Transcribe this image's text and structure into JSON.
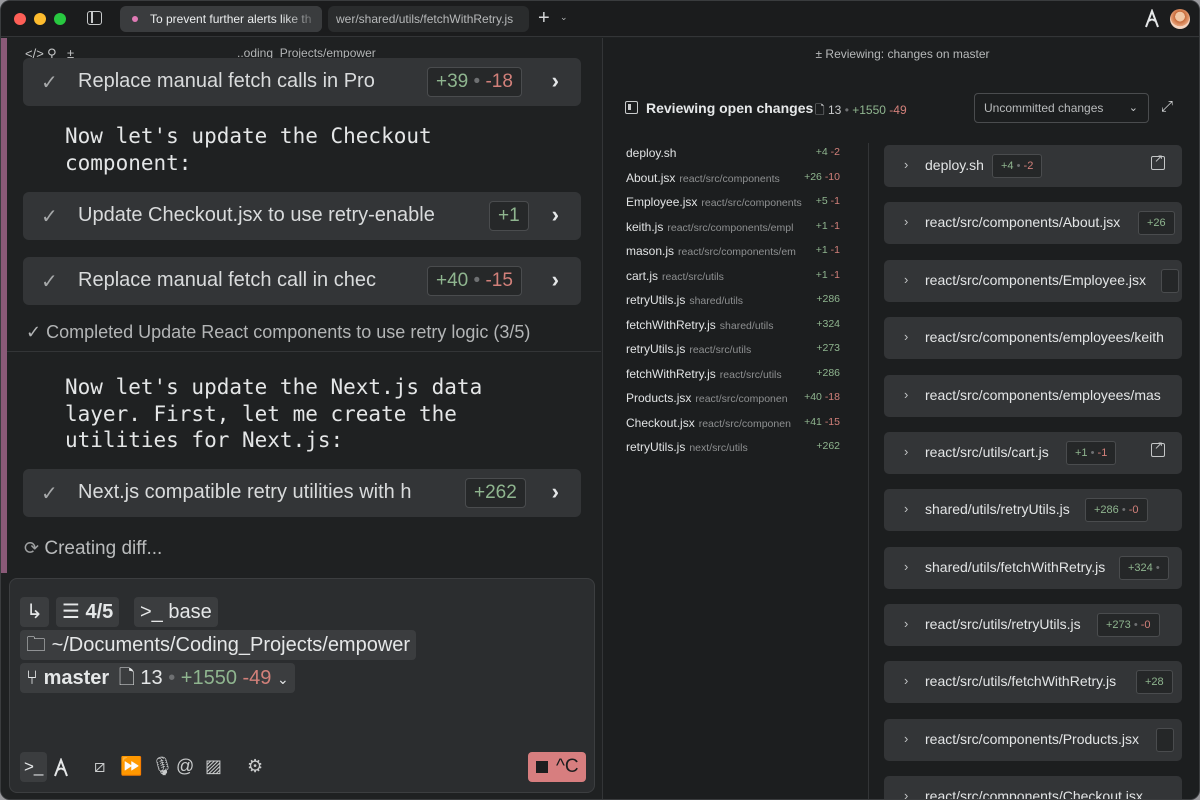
{
  "titlebar": {
    "tab1_title": "To prevent further alerts like th",
    "tab2_title": "wer/shared/utils/fetchWithRetry.js",
    "new_tab": "+",
    "tab_menu": "⌄"
  },
  "left": {
    "toolbar_path": "..oding_Projects/empower",
    "cards": [
      {
        "text": "Replace manual fetch calls in Pro",
        "add": "+39",
        "del": "-18"
      },
      {
        "text": "Update Checkout.jsx to use retry-enable",
        "add": "+1",
        "del": ""
      },
      {
        "text": "Replace manual fetch call in chec",
        "add": "+40",
        "del": "-15"
      },
      {
        "text": "Next.js compatible retry utilities with h",
        "add": "+262",
        "del": ""
      }
    ],
    "bullet_sep": "•",
    "message1": "Now let's update the Checkout\ncomponent:",
    "completed": "Completed Update React components to use retry logic (3/5)",
    "message2": "Now let's update the Next.js data\nlayer. First, let me create the\nutilities for Next.js:",
    "creating": "Creating diff..."
  },
  "input": {
    "steps": "4/5",
    "env": "base",
    "cwd": "~/Documents/Coding_Projects/empower",
    "branch": "master",
    "files": "13",
    "add": "+1550",
    "del": "-49",
    "stop_label": "^C"
  },
  "right": {
    "header": "Reviewing: changes on master",
    "title": "Reviewing open changes",
    "files_count": "13",
    "add": "+1550",
    "del": "-49",
    "dropdown": "Uncommitted changes",
    "file_list": [
      {
        "name": "deploy.sh",
        "path": "",
        "add": "+4",
        "del": "-2"
      },
      {
        "name": "About.jsx",
        "path": "react/src/components",
        "add": "+26",
        "del": "-10"
      },
      {
        "name": "Employee.jsx",
        "path": "react/src/components",
        "add": "+5",
        "del": "-1"
      },
      {
        "name": "keith.js",
        "path": "react/src/components/empl",
        "add": "+1",
        "del": "-1"
      },
      {
        "name": "mason.js",
        "path": "react/src/components/em",
        "add": "+1",
        "del": "-1"
      },
      {
        "name": "cart.js",
        "path": "react/src/utils",
        "add": "+1",
        "del": "-1"
      },
      {
        "name": "retryUtils.js",
        "path": "shared/utils",
        "add": "+286",
        "del": ""
      },
      {
        "name": "fetchWithRetry.js",
        "path": "shared/utils",
        "add": "+324",
        "del": ""
      },
      {
        "name": "retryUtils.js",
        "path": "react/src/utils",
        "add": "+273",
        "del": ""
      },
      {
        "name": "fetchWithRetry.js",
        "path": "react/src/utils",
        "add": "+286",
        "del": ""
      },
      {
        "name": "Products.jsx",
        "path": "react/src/componen",
        "add": "+40",
        "del": "-18"
      },
      {
        "name": "Checkout.jsx",
        "path": "react/src/componen",
        "add": "+41",
        "del": "-15"
      },
      {
        "name": "retryUtils.js",
        "path": "next/src/utils",
        "add": "+262",
        "del": ""
      }
    ],
    "file_cards": [
      {
        "path": "deploy.sh",
        "add": "+4",
        "del": "-2"
      },
      {
        "path": "react/src/components/About.jsx",
        "add": "+26",
        "del": ""
      },
      {
        "path": "react/src/components/Employee.jsx",
        "add": "",
        "del": ""
      },
      {
        "path": "react/src/components/employees/keith",
        "add": "",
        "del": ""
      },
      {
        "path": "react/src/components/employees/mas",
        "add": "",
        "del": ""
      },
      {
        "path": "react/src/utils/cart.js",
        "add": "+1",
        "del": "-1"
      },
      {
        "path": "shared/utils/retryUtils.js",
        "add": "+286",
        "del": "-0"
      },
      {
        "path": "shared/utils/fetchWithRetry.js",
        "add": "+324",
        "del": ""
      },
      {
        "path": "react/src/utils/retryUtils.js",
        "add": "+273",
        "del": "-0"
      },
      {
        "path": "react/src/utils/fetchWithRetry.js",
        "add": "+28",
        "del": ""
      },
      {
        "path": "react/src/components/Products.jsx",
        "add": "",
        "del": ""
      },
      {
        "path": "react/src/components/Checkout.jsx",
        "add": "",
        "del": ""
      }
    ]
  },
  "colors": {
    "add": "#8fb58f",
    "del": "#d2807a",
    "accent": "#d77e7f"
  }
}
